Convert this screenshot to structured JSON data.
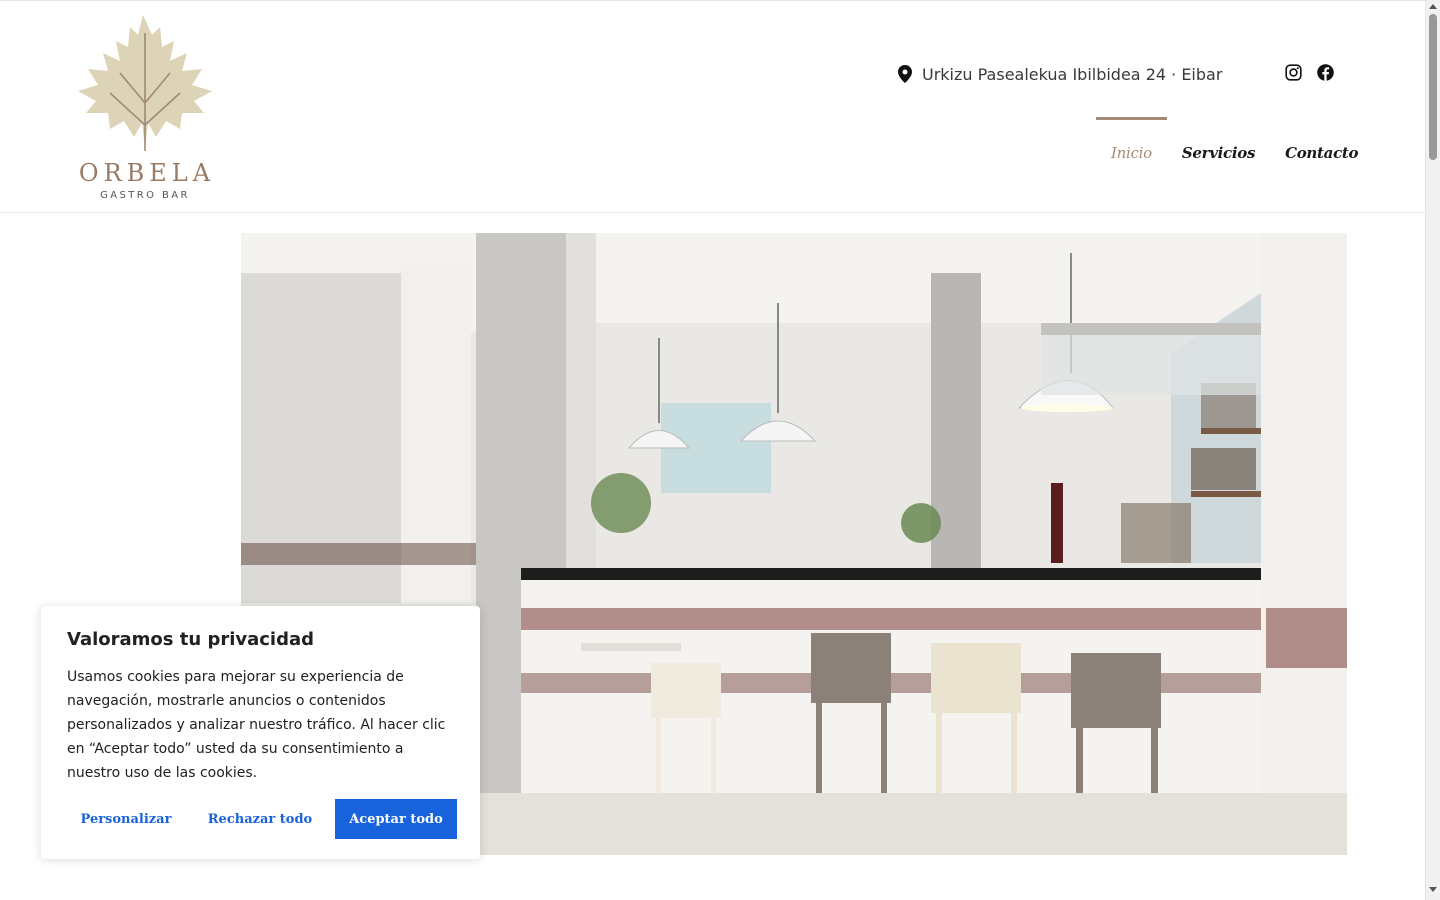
{
  "header": {
    "logo": {
      "name": "ORBELA",
      "subtitle": "GASTRO BAR"
    },
    "address": "Urkizu Pasealekua Ibilbidea 24 · Eibar",
    "social": [
      {
        "icon": "instagram-icon"
      },
      {
        "icon": "facebook-icon"
      }
    ],
    "nav": [
      {
        "label": "Inicio",
        "active": true
      },
      {
        "label": "Servicios",
        "active": false
      },
      {
        "label": "Contacto",
        "active": false
      }
    ]
  },
  "hero": {
    "description_image": "bar-interior"
  },
  "cookie_banner": {
    "title": "Valoramos tu privacidad",
    "text": "Usamos cookies para mejorar su experiencia de navegación, mostrarle anuncios o contenidos personalizados y analizar nuestro tráfico. Al hacer clic en “Aceptar todo” usted da su consentimiento a nuestro uso de las cookies.",
    "buttons": {
      "customize": "Personalizar",
      "reject": "Rechazar todo",
      "accept": "Aceptar todo"
    }
  },
  "colors": {
    "accent": "#a48b76",
    "button_blue": "#1863dc",
    "logo_leaf": "#ddd3b6",
    "logo_text": "#9a7a63"
  }
}
